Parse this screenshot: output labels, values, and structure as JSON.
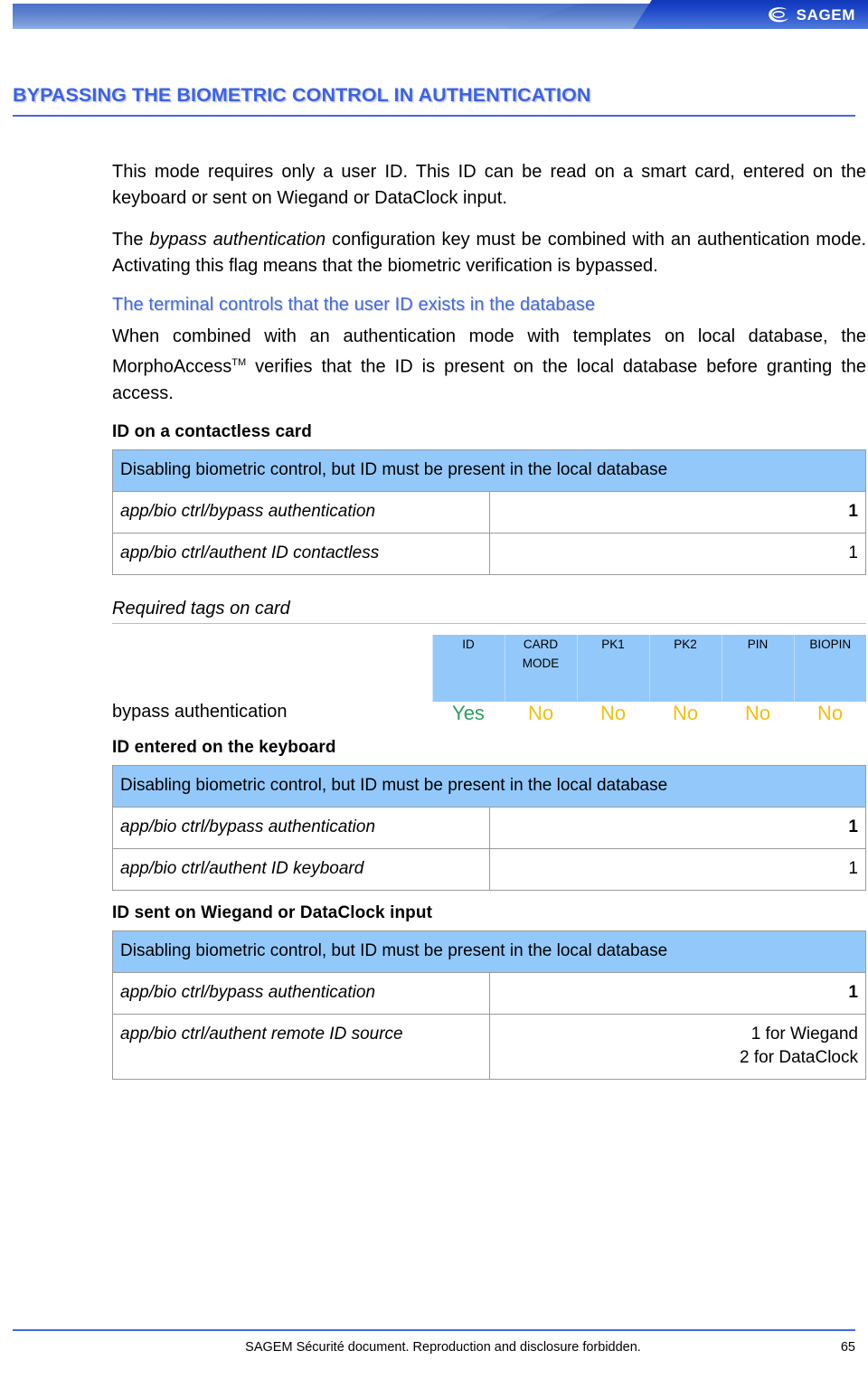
{
  "header": {
    "brand": "SAGEM",
    "logo_icon": "sagem-eye-logo-icon"
  },
  "title": "BYPASSING THE BIOMETRIC CONTROL IN AUTHENTICATION",
  "body": {
    "paragraph_1": "This mode requires only a user ID. This ID can be read on a smart card, entered on the keyboard or sent on Wiegand or DataClock input.",
    "paragraph_2_part1": "The ",
    "paragraph_2_italic": "bypass authentication",
    "paragraph_2_part2": " configuration key must be combined with an authentication mode. Activating this flag means that the biometric verification is bypassed.",
    "blue_subheading": "The terminal controls that the user ID exists in the database",
    "paragraph_3_part1": "When combined with an authentication mode with templates on local database, the MorphoAccess",
    "paragraph_3_sup": "TM",
    "paragraph_3_part2": " verifies that the ID is present on the local database before granting the access."
  },
  "section_contactless": {
    "heading": "ID on a contactless card",
    "table": {
      "header": "Disabling biometric control, but ID must be present in the local database",
      "rows": [
        {
          "key": "app/bio ctrl/bypass authentication",
          "value": "1",
          "bold": true
        },
        {
          "key": "app/bio ctrl/authent ID contactless",
          "value": "1",
          "bold": false
        }
      ]
    }
  },
  "required_tags": {
    "title": "Required tags on card",
    "columns": [
      "ID",
      "CARD MODE",
      "PK1",
      "PK2",
      "PIN",
      "BIOPIN"
    ],
    "columns_split": [
      [
        "ID"
      ],
      [
        "CARD",
        "MODE"
      ],
      [
        "PK1"
      ],
      [
        "PK2"
      ],
      [
        "PIN"
      ],
      [
        "BIOPIN"
      ]
    ],
    "row_label": "bypass authentication",
    "values": [
      "Yes",
      "No",
      "No",
      "No",
      "No",
      "No"
    ],
    "colors": {
      "yes": "#2e9e63",
      "no": "#f5bd13"
    }
  },
  "section_keyboard": {
    "heading": "ID entered on the keyboard",
    "table": {
      "header": "Disabling biometric control, but ID must be present in the local database",
      "rows": [
        {
          "key": "app/bio ctrl/bypass authentication",
          "value": "1",
          "bold": true
        },
        {
          "key": "app/bio ctrl/authent ID keyboard",
          "value": "1",
          "bold": false
        }
      ]
    }
  },
  "section_remote": {
    "heading": "ID sent on Wiegand or DataClock input",
    "table": {
      "header": "Disabling biometric control, but ID must be present in the local database",
      "rows": [
        {
          "key": "app/bio ctrl/bypass authentication",
          "value": "1",
          "bold": true
        },
        {
          "key": "app/bio ctrl/authent remote ID source",
          "value": "1 for Wiegand\n2 for DataClock",
          "bold": false
        }
      ]
    }
  },
  "footer": {
    "note": "SAGEM Sécurité document. Reproduction and disclosure forbidden.",
    "page": "65"
  },
  "colors": {
    "heading_blue": "#4169e1",
    "table_header_blue": "#93c8fa",
    "rule_blue": "#4169e1"
  }
}
